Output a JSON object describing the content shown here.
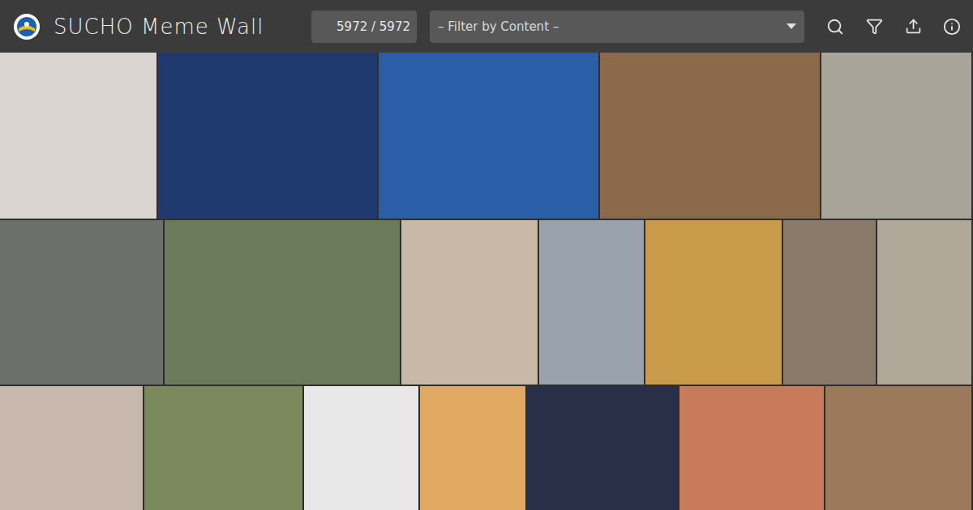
{
  "app": {
    "title": "SUCHO Meme Wall",
    "counter": "5972 / 5972"
  },
  "filter": {
    "placeholder": "– Filter by Content –"
  },
  "meme_rows": [
    [
      {
        "color": "#d9d4cf"
      },
      {
        "color": "#1e3a6e"
      },
      {
        "color": "#2a5fa8"
      },
      {
        "color": "#8a6a4a"
      },
      {
        "color": "#a8a49a"
      }
    ],
    [
      {
        "color": "#6c6f6a"
      },
      {
        "color": "#6b7a5a"
      },
      {
        "color": "#c7b8a8"
      },
      {
        "color": "#9aa3ad"
      },
      {
        "color": "#c89a4a"
      },
      {
        "color": "#8a7a6a"
      },
      {
        "color": "#b0a898"
      }
    ],
    [
      {
        "color": "#c9b8ae"
      },
      {
        "color": "#7b8a5c"
      },
      {
        "color": "#e8e8e8"
      },
      {
        "color": "#e0a860"
      },
      {
        "color": "#2a2f48"
      },
      {
        "color": "#c87a5a"
      },
      {
        "color": "#9a7a5a"
      }
    ]
  ]
}
